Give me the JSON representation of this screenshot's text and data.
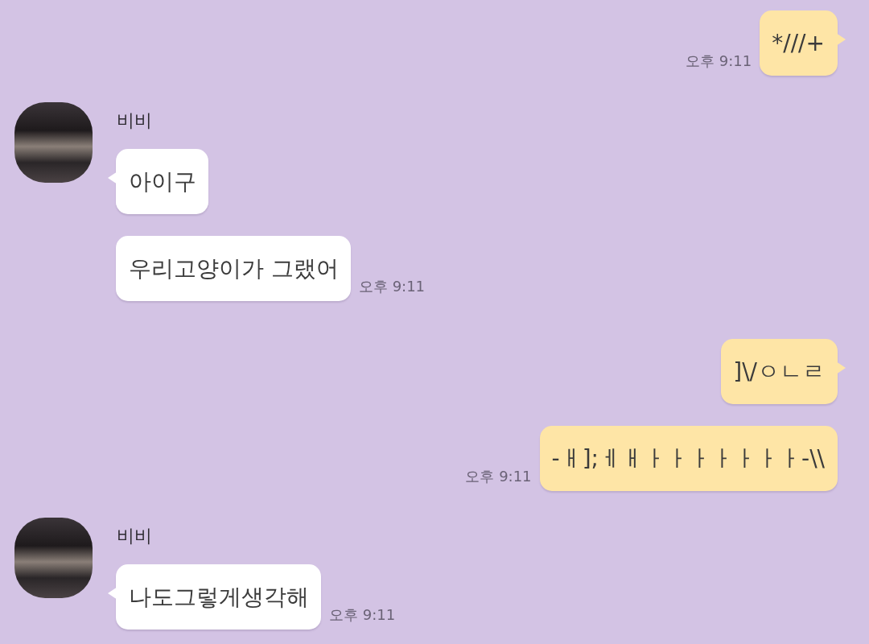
{
  "chat": [
    {
      "kind": "sent",
      "bubbles": [
        {
          "text": "*///+",
          "time": "오후 9:11"
        }
      ]
    },
    {
      "kind": "received",
      "sender": "비비",
      "bubbles": [
        {
          "text": "아이구"
        },
        {
          "text": "우리고양이가 그랬어",
          "time": "오후 9:11"
        }
      ]
    },
    {
      "kind": "sent",
      "bubbles": [
        {
          "text": "]\\/ㅇㄴㄹ"
        },
        {
          "text": "-ㅐ];ㅔㅐㅏㅏㅏㅏㅏㅏㅏ-\\\\",
          "time": "오후 9:11"
        }
      ]
    },
    {
      "kind": "received",
      "sender": "비비",
      "bubbles": [
        {
          "text": "나도그렇게생각해",
          "time": "오후 9:11"
        }
      ]
    }
  ]
}
